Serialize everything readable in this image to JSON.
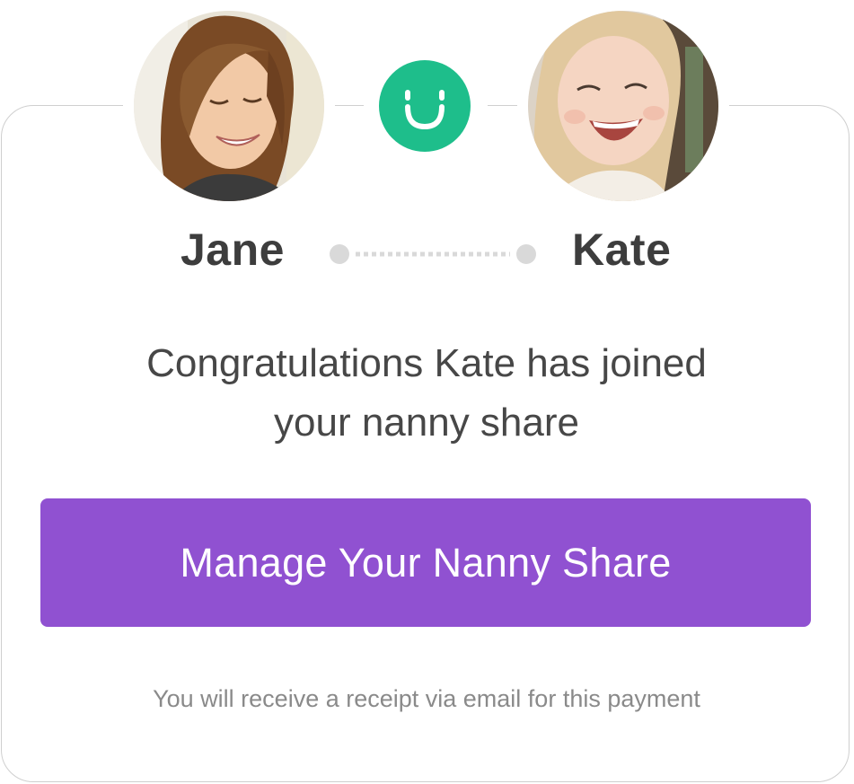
{
  "participants": {
    "left_name": "Jane",
    "right_name": "Kate"
  },
  "icons": {
    "left_avatar": "jane-avatar-photo",
    "right_avatar": "kate-avatar-photo",
    "logo": "smile-logo-icon",
    "connector": "dotted-connector-icon"
  },
  "message": {
    "line1": "Congratulations Kate has joined",
    "line2": "your nanny share"
  },
  "cta": {
    "label": "Manage Your Nanny Share"
  },
  "footer": {
    "receipt_note": "You will receive a receipt via email for this payment"
  },
  "colors": {
    "accent": "#9051d1",
    "logo": "#1ebe8b",
    "name_text": "#3d3d3d",
    "body_text": "#474747",
    "muted_text": "#8a8a8a",
    "card_border": "#cfcfcf",
    "connector": "#d9d9d9"
  }
}
